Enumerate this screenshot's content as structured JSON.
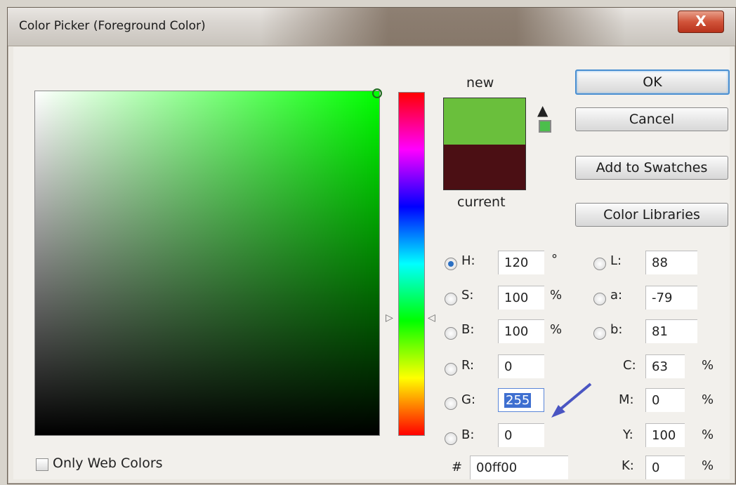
{
  "window": {
    "title": "Color Picker (Foreground Color)",
    "close_label": "X"
  },
  "preview": {
    "new_label": "new",
    "current_label": "current",
    "new_color": "#6abf3c",
    "current_color": "#4b0f14"
  },
  "buttons": {
    "ok": "OK",
    "cancel": "Cancel",
    "add_to_swatches": "Add to Swatches",
    "color_libraries": "Color Libraries"
  },
  "hsb": [
    {
      "label": "H:",
      "value": "120",
      "unit": "°",
      "selected": true
    },
    {
      "label": "S:",
      "value": "100",
      "unit": "%",
      "selected": false
    },
    {
      "label": "B:",
      "value": "100",
      "unit": "%",
      "selected": false
    }
  ],
  "lab": [
    {
      "label": "L:",
      "value": "88"
    },
    {
      "label": "a:",
      "value": "-79"
    },
    {
      "label": "b:",
      "value": "81"
    }
  ],
  "rgb": [
    {
      "label": "R:",
      "value": "0"
    },
    {
      "label": "G:",
      "value": "255"
    },
    {
      "label": "B:",
      "value": "0"
    }
  ],
  "cmyk": [
    {
      "label": "C:",
      "value": "63",
      "unit": "%"
    },
    {
      "label": "M:",
      "value": "0",
      "unit": "%"
    },
    {
      "label": "Y:",
      "value": "100",
      "unit": "%"
    },
    {
      "label": "K:",
      "value": "0",
      "unit": "%"
    }
  ],
  "hex": {
    "label": "#",
    "value": "00ff00"
  },
  "options": {
    "only_web_colors": "Only Web Colors"
  },
  "icons": {
    "gamut_warning": "warning-triangle-icon",
    "web_safe": "web-safe-swatch-icon"
  }
}
